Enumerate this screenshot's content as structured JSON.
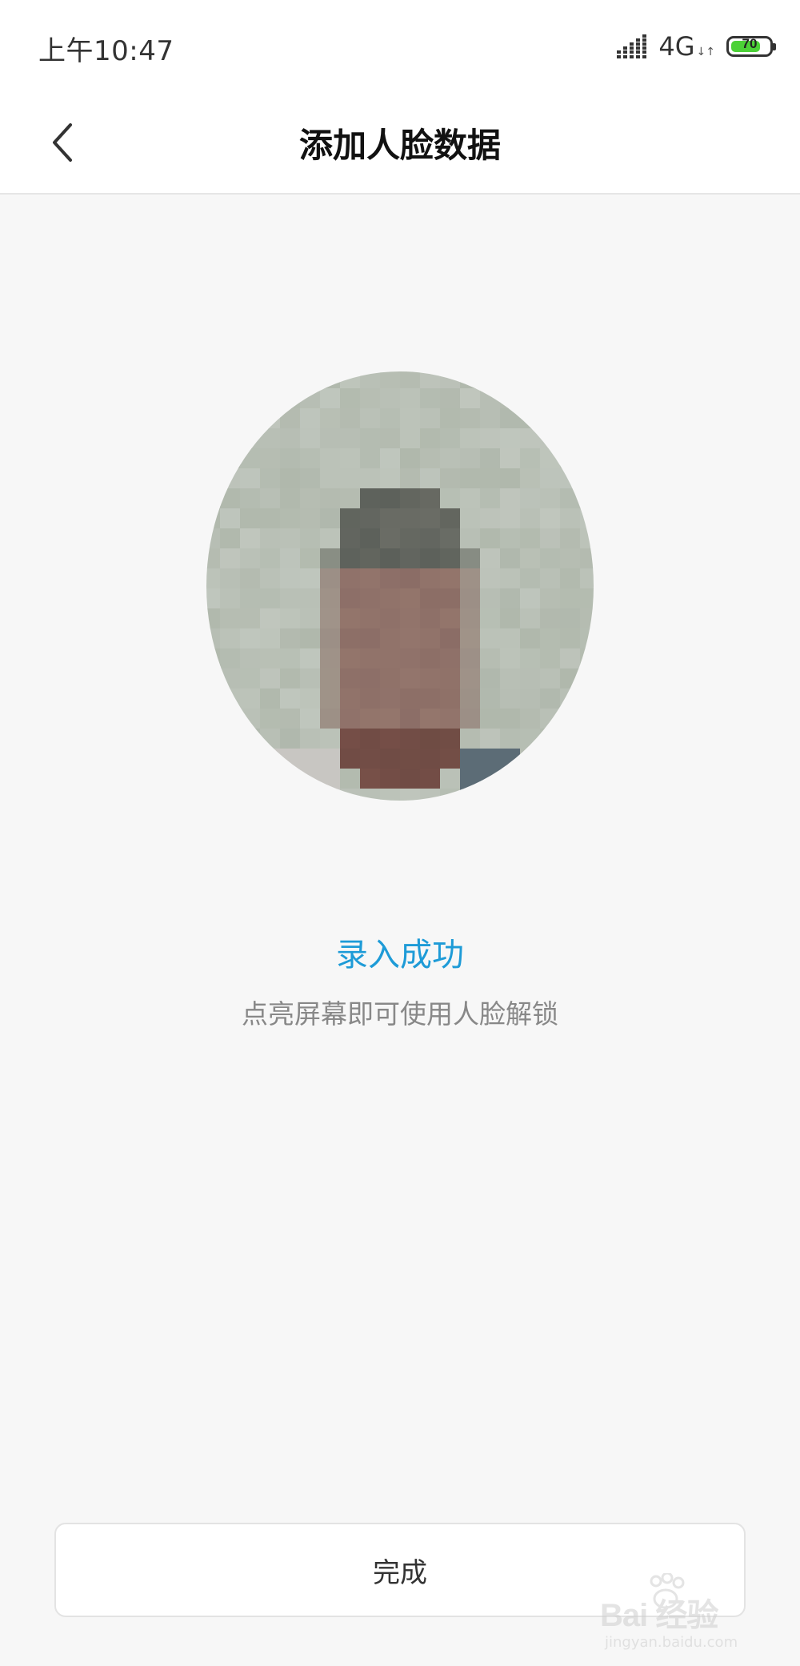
{
  "status_bar": {
    "time": "上午10:47",
    "network": "4G",
    "network_arrows": "↓↑",
    "battery_level": "70",
    "icons": [
      "signal-icon",
      "battery-icon"
    ]
  },
  "header": {
    "title": "添加人脸数据",
    "back_icon": "chevron-left-icon"
  },
  "face_image": {
    "icon": "face-avatar"
  },
  "result": {
    "title": "录入成功",
    "subtitle": "点亮屏幕即可使用人脸解锁"
  },
  "footer": {
    "done_label": "完成"
  },
  "watermark": {
    "brand": "Bai 经验",
    "url": "jingyan.baidu.com"
  },
  "colors": {
    "accent": "#1e9bd7",
    "background": "#f7f7f7",
    "battery": "#4cd137"
  }
}
